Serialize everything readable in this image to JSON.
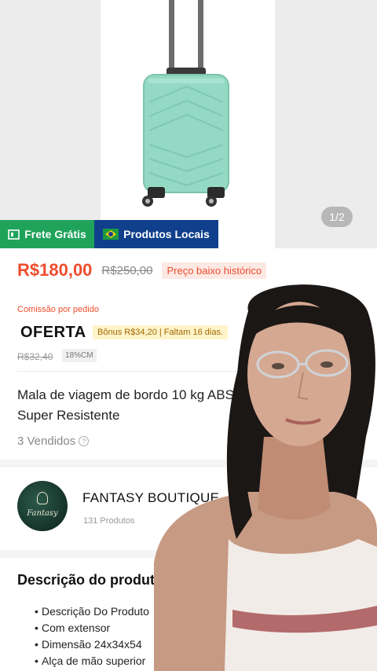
{
  "gallery": {
    "counter": "1/2"
  },
  "badges": {
    "free_shipping": "Frete Grátis",
    "local_products": "Produtos Locais"
  },
  "pricing": {
    "price": "R$180,00",
    "original_price": "R$250,00",
    "low_price_tag": "Preço baixo histórico"
  },
  "affiliate": {
    "commission_label": "Comissão por pedido",
    "offer_label": "OFERTA",
    "bonus": "Bônus R$34,20 | Faltam 16 dias.",
    "original_commission": "R$32,40",
    "commission_rate": "18%CM"
  },
  "product": {
    "title": "Mala de viagem de bordo 10 kg ABS com extensor e Super Resistente",
    "sold": "3 Vendidos"
  },
  "shop": {
    "name": "FANTASY BOUTIQUE",
    "products": "131 Produtos",
    "logo_text": "Fantasy"
  },
  "description": {
    "heading": "Descrição do produto",
    "items": [
      "Descrição Do Produto",
      "Com extensor",
      "Dimensão 24x34x54",
      "Alça de mão superior"
    ]
  },
  "colors": {
    "accent": "#ee4d2d",
    "shipping_badge": "#1fa35a",
    "local_badge": "#10408c",
    "suitcase": "#94d9c4"
  },
  "icons": [
    "truck-icon",
    "brazil-flag-icon",
    "help-icon"
  ]
}
